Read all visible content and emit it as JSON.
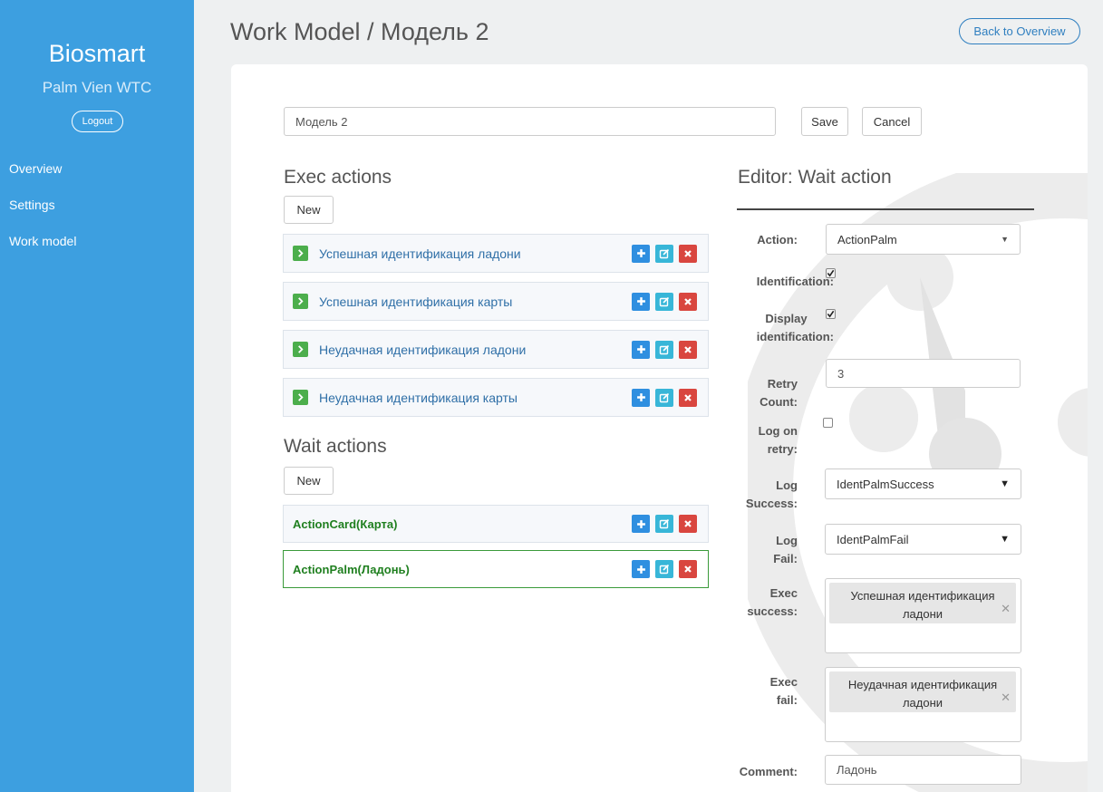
{
  "sidebar": {
    "brand": "Biosmart",
    "subtitle": "Palm Vien WTC",
    "logout_label": "Logout",
    "nav": [
      {
        "label": "Overview"
      },
      {
        "label": "Settings"
      },
      {
        "label": "Work model"
      }
    ]
  },
  "header": {
    "title": "Work Model / Модель 2",
    "back_label": "Back to Overview"
  },
  "model_form": {
    "name_value": "Модель 2",
    "save_label": "Save",
    "cancel_label": "Cancel"
  },
  "exec_actions": {
    "title": "Exec actions",
    "new_label": "New",
    "items": [
      {
        "label": "Успешная идентификация ладони"
      },
      {
        "label": "Успешная идентификация карты"
      },
      {
        "label": "Неудачная идентификация ладони"
      },
      {
        "label": "Неудачная идентификация карты"
      }
    ]
  },
  "wait_actions": {
    "title": "Wait actions",
    "new_label": "New",
    "items": [
      {
        "label": "ActionCard(Карта)",
        "selected": false
      },
      {
        "label": "ActionPalm(Ладонь)",
        "selected": true
      }
    ]
  },
  "editor": {
    "title": "Editor: Wait action",
    "action_label": "Action:",
    "action_value": "ActionPalm",
    "identification_label": "Identification:",
    "identification_checked": true,
    "display_identification_label_1": "Display",
    "display_identification_label_2": "identification:",
    "display_identification_checked": true,
    "retry_label_1": "Retry",
    "retry_label_2": "Count:",
    "retry_value": "3",
    "log_on_retry_label_1": "Log on",
    "log_on_retry_label_2": "retry:",
    "log_on_retry_checked": false,
    "log_success_label_1": "Log",
    "log_success_label_2": "Success:",
    "log_success_value": "IdentPalmSuccess",
    "log_fail_label_1": "Log",
    "log_fail_label_2": "Fail:",
    "log_fail_value": "IdentPalmFail",
    "exec_success_label_1": "Exec",
    "exec_success_label_2": "success:",
    "exec_success_tag_line1": "Успешная идентификация",
    "exec_success_tag_line2": "ладони",
    "exec_fail_label_1": "Exec",
    "exec_fail_label_2": "fail:",
    "exec_fail_tag_line1": "Неудачная идентификация",
    "exec_fail_tag_line2": "ладони",
    "comment_label": "Comment:",
    "comment_value": "Ладонь"
  },
  "colors": {
    "sidebar": "#3d9fe0",
    "accent": "#2f7fc0",
    "success": "#4cae4c",
    "danger": "#d9463f",
    "info": "#38b6d8",
    "primary": "#2f8fe0"
  },
  "icons": {
    "arrow": "chevron-right-icon",
    "plus": "plus-icon",
    "edit": "edit-icon",
    "delete": "delete-icon",
    "tag_remove": "close-icon"
  }
}
